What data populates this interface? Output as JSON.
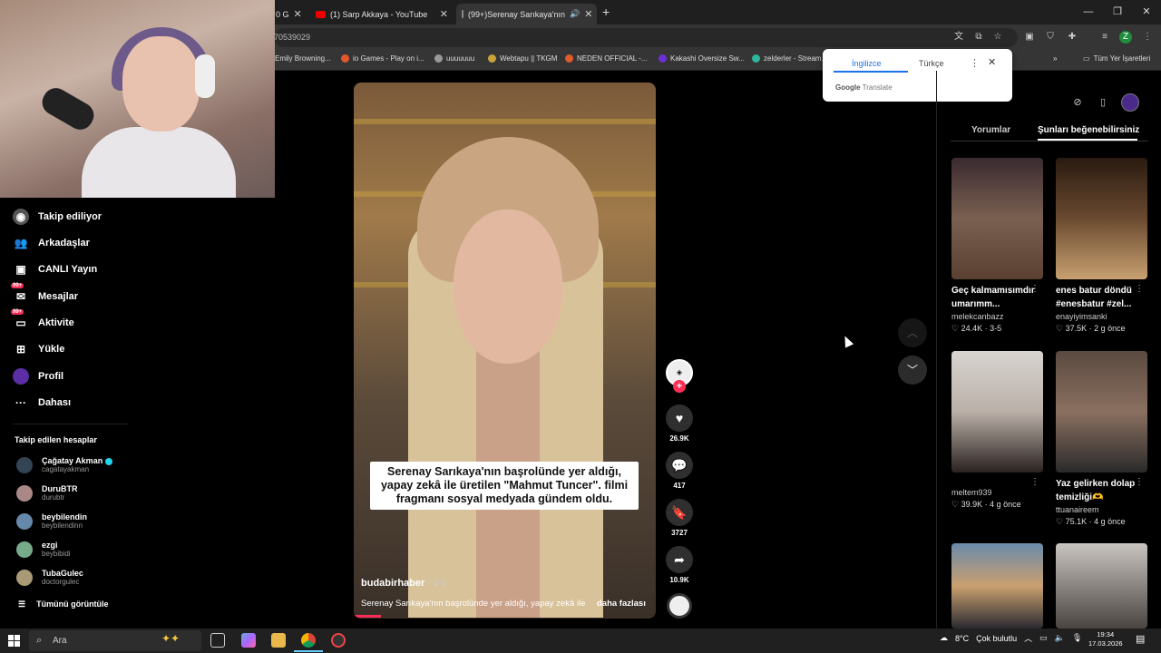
{
  "browser": {
    "tabs": [
      {
        "label": "0 G",
        "close": "✕"
      },
      {
        "label": "(1) Sarp Akkaya - YouTube",
        "close": "✕"
      },
      {
        "label": "(99+)Serenay Sarıkaya'nın",
        "close": "✕"
      }
    ],
    "new_tab": "+",
    "url": "70539029",
    "bookmarks": [
      "Emily Browning...",
      "io Games - Play on i...",
      "uuuuuuu",
      "Webtapu || TKGM",
      "NEDEN OFFICIAL -...",
      "Kakashi Oversize Sw...",
      "zelderler - Stream..."
    ],
    "all_bookmarks": "Tüm Yer İşaretleri",
    "profile_initial": "Z"
  },
  "translate_popup": {
    "lang_source": "İngilizce",
    "lang_target": "Türkçe",
    "brand": "Google",
    "brand_suffix": "Translate"
  },
  "sidebar": {
    "nav": [
      {
        "label": "Takip ediliyor",
        "icon": "following-icon"
      },
      {
        "label": "Arkadaşlar",
        "icon": "friends-icon"
      },
      {
        "label": "CANLI Yayın",
        "icon": "live-icon"
      },
      {
        "label": "Mesajlar",
        "icon": "messages-icon",
        "badge": "99+"
      },
      {
        "label": "Aktivite",
        "icon": "activity-icon",
        "badge": "99+"
      },
      {
        "label": "Yükle",
        "icon": "upload-icon"
      },
      {
        "label": "Profil",
        "icon": "profile-icon"
      },
      {
        "label": "Dahası",
        "icon": "more-icon"
      }
    ],
    "followed_title": "Takip edilen hesaplar",
    "accounts": [
      {
        "name": "Çağatay Akman",
        "handle": "cagatayakman",
        "verified": true
      },
      {
        "name": "DuruBTR",
        "handle": "durubtr"
      },
      {
        "name": "beybilendin",
        "handle": "beybilendinn"
      },
      {
        "name": "ezgi",
        "handle": "beybibidi"
      },
      {
        "name": "TubaGulec",
        "handle": "doctorgulec"
      }
    ],
    "see_all": "Tümünü görüntüle"
  },
  "video": {
    "caption": "Serenay Sarıkaya'nın başrolünde yer aldığı, yapay zekâ ile üretilen \"Mahmut Tuncer\". filmi fragmanı sosyal medyada gündem oldu.",
    "author": "budabirhaber",
    "date": "· 3-5",
    "description": "Serenay Sarıkaya'nın başrolünde yer aldığı, yapay zekâ ile",
    "more": "daha fazlası",
    "likes": "26.9K",
    "comments": "417",
    "saves": "3727",
    "shares": "10.9K",
    "follow_plus": "+"
  },
  "right_panel": {
    "tab_comments": "Yorumlar",
    "tab_suggest": "Şunları beğenebilirsiniz",
    "cards": [
      {
        "title": "Geç kalmamısımdır umarımm...",
        "user": "melekcanbazz",
        "likes": "24.4K",
        "date": "3-5"
      },
      {
        "title": "enes batur döndü #enesbatur #zel...",
        "user": "enayiyimsanki",
        "likes": "37.5K",
        "date": "2 g önce"
      },
      {
        "title": "",
        "user": "meltem939",
        "likes": "39.9K",
        "date": "4 g önce"
      },
      {
        "title": "Yaz gelirken dolap temizliği🫶",
        "user": "ttuanaireem",
        "likes": "75.1K",
        "date": "4 g önce"
      }
    ]
  },
  "taskbar": {
    "search": "Ara",
    "weather": "8°C",
    "weather_text": "Çok bulutlu",
    "time": "19:34",
    "date": "17.03.2026"
  }
}
